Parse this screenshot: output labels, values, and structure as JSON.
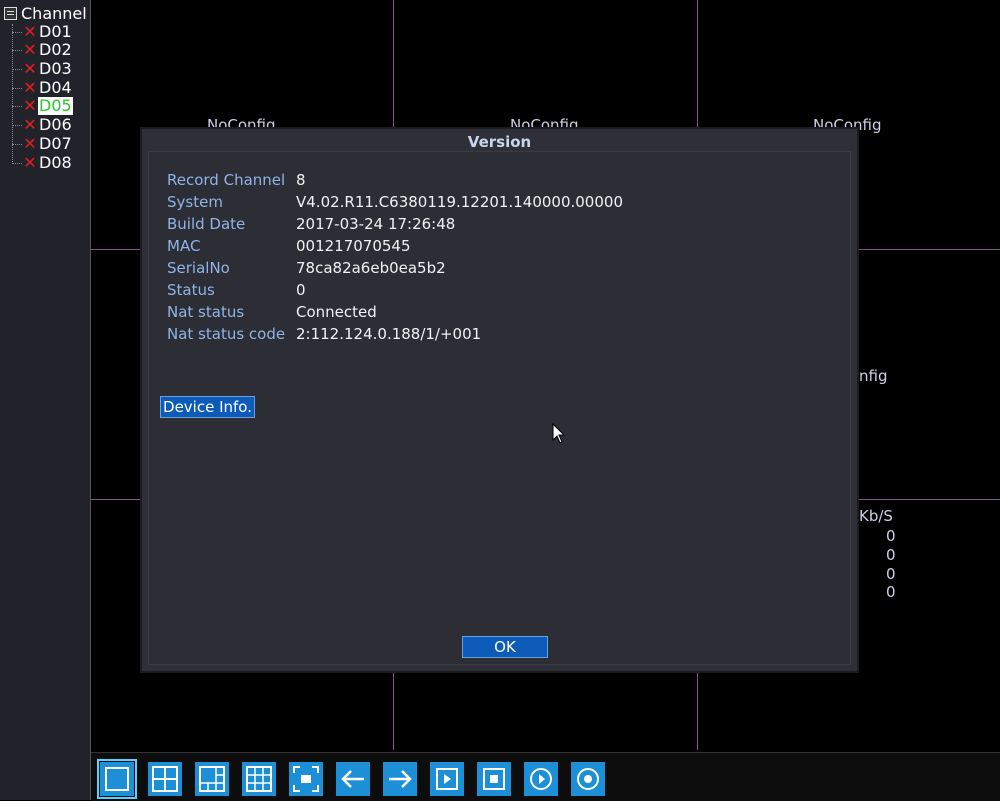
{
  "sidebar": {
    "root_label": "Channel",
    "channels": [
      {
        "label": "D01",
        "status": "no-signal"
      },
      {
        "label": "D02",
        "status": "no-signal"
      },
      {
        "label": "D03",
        "status": "no-signal"
      },
      {
        "label": "D04",
        "status": "no-signal"
      },
      {
        "label": "D05",
        "status": "no-signal",
        "selected": true
      },
      {
        "label": "D06",
        "status": "no-signal"
      },
      {
        "label": "D07",
        "status": "no-signal"
      },
      {
        "label": "D08",
        "status": "no-signal"
      }
    ]
  },
  "grid": {
    "cell_labels": [
      "NoConfig",
      "NoConfig",
      "NoConfig",
      "nfig"
    ],
    "kbs_header": "Kb/S",
    "kbs_values": [
      "0",
      "0",
      "0",
      "0"
    ]
  },
  "dialog": {
    "title": "Version",
    "fields": [
      {
        "key": "Record Channel",
        "value": "8"
      },
      {
        "key": "System",
        "value": "V4.02.R11.C6380119.12201.140000.00000"
      },
      {
        "key": "Build Date",
        "value": "2017-03-24 17:26:48"
      },
      {
        "key": "MAC",
        "value": "001217070545"
      },
      {
        "key": "SerialNo",
        "value": "78ca82a6eb0ea5b2"
      },
      {
        "key": "Status",
        "value": "0"
      },
      {
        "key": "Nat status",
        "value": "Connected"
      },
      {
        "key": "Nat status code",
        "value": "2:112.124.0.188/1/+001"
      }
    ],
    "device_info_button": "Device Info.",
    "ok_button": "OK"
  },
  "toolbar": {
    "buttons": [
      {
        "icon": "single-view-icon",
        "active": true
      },
      {
        "icon": "quad-view-icon"
      },
      {
        "icon": "six-view-icon"
      },
      {
        "icon": "nine-view-icon"
      },
      {
        "icon": "fullscreen-icon"
      },
      {
        "icon": "previous-arrow-icon"
      },
      {
        "icon": "next-arrow-icon"
      },
      {
        "icon": "playback-icon"
      },
      {
        "icon": "record-icon"
      },
      {
        "icon": "play-circle-icon"
      },
      {
        "icon": "circle-record-icon"
      }
    ]
  },
  "colors": {
    "accent": "#1c8fd6",
    "dialog_bg": "#2c2d35",
    "field_key": "#8fb4e8",
    "grid_line": "#7a5a8a",
    "no_signal_x": "#e02020",
    "selected_text": "#2fc52f"
  }
}
